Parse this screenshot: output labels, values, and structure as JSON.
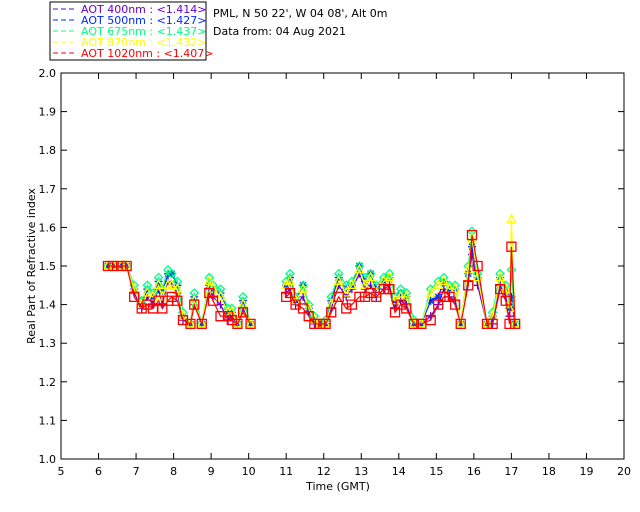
{
  "header": {
    "site": "PML, N 50 22', W 04 08', Alt 0m",
    "date": "Data from: 04 Aug 2021"
  },
  "chart_data": {
    "type": "line",
    "xlabel": "Time (GMT)",
    "ylabel": "Real Part of Refractive index",
    "xlim": [
      5,
      20
    ],
    "ylim": [
      1.0,
      2.0
    ],
    "xticks": [
      "5",
      "6",
      "7",
      "8",
      "9",
      "10",
      "11",
      "12",
      "13",
      "14",
      "15",
      "16",
      "17",
      "18",
      "19",
      "20"
    ],
    "yticks": [
      "1.0",
      "1.1",
      "1.2",
      "1.3",
      "1.4",
      "1.5",
      "1.6",
      "1.7",
      "1.8",
      "1.9",
      "2.0"
    ],
    "grid": false,
    "legend_placement": "top-left-outside",
    "x": [
      6.25,
      6.4,
      6.6,
      6.75,
      6.95,
      7.15,
      7.3,
      7.45,
      7.6,
      7.7,
      7.85,
      7.95,
      8.1,
      8.25,
      8.45,
      8.55,
      8.75,
      8.95,
      9.05,
      9.25,
      9.45,
      9.55,
      9.7,
      9.85,
      10.05,
      11.0,
      11.1,
      11.25,
      11.45,
      11.6,
      11.75,
      11.9,
      12.05,
      12.2,
      12.4,
      12.6,
      12.75,
      12.95,
      13.1,
      13.25,
      13.4,
      13.6,
      13.75,
      13.9,
      14.05,
      14.2,
      14.4,
      14.6,
      14.85,
      15.05,
      15.2,
      15.35,
      15.5,
      15.65,
      15.85,
      15.95,
      16.1,
      16.35,
      16.5,
      16.7,
      16.85,
      16.95,
      17.0,
      17.1
    ],
    "series": [
      {
        "name": "AOT  400nm : <1.414>",
        "color": "#6a00c8",
        "marker": "plus",
        "values": [
          1.5,
          1.5,
          1.5,
          1.5,
          1.43,
          1.39,
          1.42,
          1.4,
          1.44,
          1.4,
          1.46,
          1.45,
          1.43,
          1.36,
          1.35,
          1.4,
          1.35,
          1.44,
          1.42,
          1.4,
          1.36,
          1.37,
          1.35,
          1.39,
          1.35,
          1.43,
          1.44,
          1.4,
          1.42,
          1.38,
          1.35,
          1.35,
          1.35,
          1.39,
          1.45,
          1.42,
          1.44,
          1.48,
          1.44,
          1.45,
          1.42,
          1.44,
          1.45,
          1.39,
          1.41,
          1.4,
          1.35,
          1.35,
          1.37,
          1.4,
          1.44,
          1.42,
          1.41,
          1.35,
          1.46,
          1.53,
          1.45,
          1.35,
          1.35,
          1.45,
          1.42,
          1.37,
          1.41,
          1.35
        ]
      },
      {
        "name": "AOT  500nm : <1.427>",
        "color": "#0028ff",
        "marker": "asterisk",
        "values": [
          1.5,
          1.5,
          1.5,
          1.5,
          1.44,
          1.4,
          1.44,
          1.42,
          1.46,
          1.43,
          1.48,
          1.48,
          1.45,
          1.37,
          1.35,
          1.42,
          1.35,
          1.45,
          1.44,
          1.43,
          1.38,
          1.38,
          1.35,
          1.41,
          1.35,
          1.45,
          1.47,
          1.41,
          1.45,
          1.39,
          1.36,
          1.35,
          1.35,
          1.41,
          1.47,
          1.44,
          1.45,
          1.5,
          1.46,
          1.48,
          1.44,
          1.46,
          1.47,
          1.41,
          1.43,
          1.42,
          1.35,
          1.35,
          1.41,
          1.42,
          1.46,
          1.44,
          1.44,
          1.35,
          1.48,
          1.55,
          1.47,
          1.35,
          1.37,
          1.47,
          1.44,
          1.39,
          1.42,
          1.35
        ]
      },
      {
        "name": "AOT  675nm : <1.437>",
        "color": "#00ff80",
        "marker": "diamond",
        "values": [
          1.5,
          1.5,
          1.5,
          1.5,
          1.45,
          1.41,
          1.45,
          1.43,
          1.47,
          1.44,
          1.49,
          1.48,
          1.46,
          1.38,
          1.35,
          1.43,
          1.35,
          1.47,
          1.45,
          1.44,
          1.39,
          1.39,
          1.35,
          1.42,
          1.35,
          1.46,
          1.48,
          1.42,
          1.45,
          1.4,
          1.37,
          1.35,
          1.36,
          1.42,
          1.48,
          1.45,
          1.46,
          1.5,
          1.47,
          1.48,
          1.45,
          1.47,
          1.48,
          1.42,
          1.44,
          1.43,
          1.36,
          1.35,
          1.44,
          1.46,
          1.47,
          1.45,
          1.45,
          1.35,
          1.5,
          1.59,
          1.48,
          1.35,
          1.38,
          1.48,
          1.45,
          1.4,
          1.49,
          1.35
        ]
      },
      {
        "name": "AOT  870nm : <1.432>",
        "color": "#ffff00",
        "marker": "triangle",
        "values": [
          1.5,
          1.5,
          1.5,
          1.5,
          1.44,
          1.4,
          1.43,
          1.42,
          1.45,
          1.42,
          1.45,
          1.45,
          1.44,
          1.37,
          1.35,
          1.41,
          1.35,
          1.46,
          1.44,
          1.42,
          1.38,
          1.38,
          1.35,
          1.4,
          1.35,
          1.45,
          1.46,
          1.41,
          1.44,
          1.39,
          1.36,
          1.35,
          1.35,
          1.4,
          1.46,
          1.43,
          1.45,
          1.49,
          1.45,
          1.47,
          1.43,
          1.46,
          1.47,
          1.41,
          1.42,
          1.42,
          1.35,
          1.35,
          1.43,
          1.45,
          1.46,
          1.44,
          1.44,
          1.35,
          1.49,
          1.57,
          1.47,
          1.35,
          1.37,
          1.47,
          1.44,
          1.39,
          1.62,
          1.35
        ]
      },
      {
        "name": "AOT 1020nm : <1.407>",
        "color": "#ff0000",
        "marker": "square",
        "values": [
          1.5,
          1.5,
          1.5,
          1.5,
          1.42,
          1.39,
          1.4,
          1.39,
          1.41,
          1.39,
          1.41,
          1.42,
          1.41,
          1.36,
          1.35,
          1.4,
          1.35,
          1.43,
          1.41,
          1.37,
          1.37,
          1.36,
          1.35,
          1.38,
          1.35,
          1.42,
          1.43,
          1.4,
          1.39,
          1.37,
          1.35,
          1.35,
          1.35,
          1.38,
          1.42,
          1.39,
          1.4,
          1.42,
          1.42,
          1.43,
          1.42,
          1.44,
          1.44,
          1.38,
          1.4,
          1.39,
          1.35,
          1.35,
          1.36,
          1.4,
          1.42,
          1.42,
          1.4,
          1.35,
          1.45,
          1.58,
          1.5,
          1.35,
          1.35,
          1.44,
          1.41,
          1.35,
          1.55,
          1.35
        ]
      }
    ]
  }
}
